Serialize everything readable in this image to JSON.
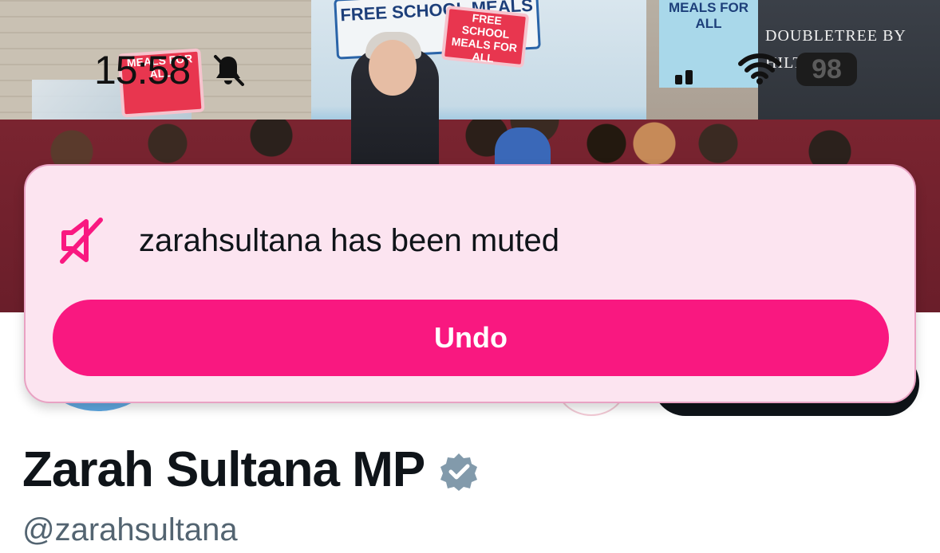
{
  "status_bar": {
    "time": "15:58",
    "battery_level": "98",
    "icons": [
      "bell-off-icon",
      "signal-icon",
      "wifi-icon",
      "battery-icon"
    ]
  },
  "header_photo": {
    "signage": {
      "bus_banner": "FREE SCHOOL MEALS",
      "red_sign": "FREE SCHOOL MEALS FOR ALL",
      "left_sign": "MEALS FOR ALL",
      "blue_poster": "MEALS FOR ALL",
      "hotel_sign": "DOUBLETREE BY HILTON"
    }
  },
  "toast": {
    "icon": "mute-icon",
    "message": "zarahsultana has been muted",
    "undo_label": "Undo",
    "accent_color": "#f91880",
    "background_color": "#fce4f0"
  },
  "profile": {
    "name": "Zarah Sultana MP",
    "handle": "@zarahsultana",
    "verified": true,
    "verified_color": "#829aab"
  }
}
